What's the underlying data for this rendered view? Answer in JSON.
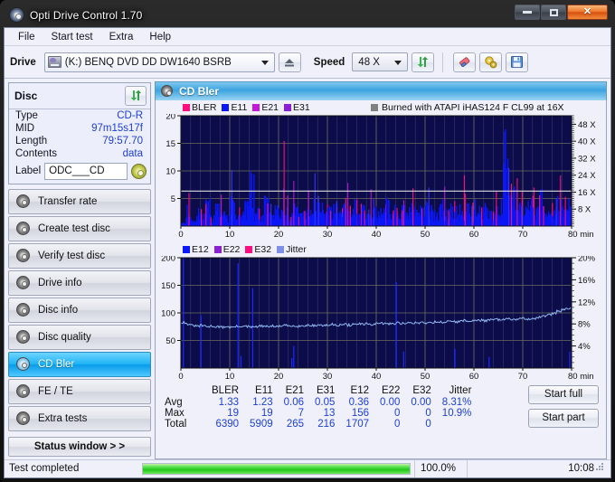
{
  "window": {
    "title": "Opti Drive Control 1.70",
    "icon": "disc-icon",
    "minimize": "–",
    "maximize": "□",
    "close": "✕"
  },
  "menu": {
    "items": [
      "File",
      "Start test",
      "Extra",
      "Help"
    ]
  },
  "toolbar": {
    "drive_label": "Drive",
    "drive_value": "(K:)  BENQ DVD DD DW1640 BSRB",
    "eject_icon": "eject-icon",
    "speed_label": "Speed",
    "speed_value": "48 X",
    "refresh_icon": "refresh-icon",
    "erase_icon": "eraser-icon",
    "settings_icon": "gears-icon",
    "save_icon": "floppy-save-icon"
  },
  "disc": {
    "title": "Disc",
    "refresh_icon": "refresh-icon",
    "rows": [
      {
        "key": "Type",
        "value": "CD-R"
      },
      {
        "key": "MID",
        "value": "97m15s17f"
      },
      {
        "key": "Length",
        "value": "79:57.70"
      },
      {
        "key": "Contents",
        "value": "data"
      }
    ],
    "label_key": "Label",
    "label_value": "ODC___CD",
    "label_icon": "cd-disc-icon"
  },
  "sidebar": {
    "items": [
      {
        "label": "Transfer rate",
        "icon": "disc-transfer-icon",
        "active": false
      },
      {
        "label": "Create test disc",
        "icon": "disc-create-icon",
        "active": false
      },
      {
        "label": "Verify test disc",
        "icon": "disc-verify-icon",
        "active": false
      },
      {
        "label": "Drive info",
        "icon": "drive-info-icon",
        "active": false
      },
      {
        "label": "Disc info",
        "icon": "disc-info-icon",
        "active": false
      },
      {
        "label": "Disc quality",
        "icon": "disc-quality-icon",
        "active": false
      },
      {
        "label": "CD Bler",
        "icon": "cd-bler-icon",
        "active": true
      },
      {
        "label": "FE / TE",
        "icon": "fe-te-icon",
        "active": false
      },
      {
        "label": "Extra tests",
        "icon": "extra-tests-icon",
        "active": false
      }
    ],
    "status_window": "Status window > >"
  },
  "content": {
    "panel_title": "CD Bler",
    "panel_icon": "cd-bler-icon"
  },
  "chart_data": [
    {
      "type": "bar",
      "name": "cd-bler-top-chart",
      "title": "",
      "annotation": "Burned with ATAPI iHAS124  F CL99 at 16X",
      "annotation_swatch": "#808080",
      "xlabel": "min",
      "ylabel": "",
      "x": [
        0,
        80
      ],
      "xticks": [
        0,
        10,
        20,
        30,
        40,
        50,
        60,
        70,
        80
      ],
      "xtick_labels": [
        "0",
        "10",
        "20",
        "30",
        "40",
        "50",
        "60",
        "70",
        "80 min"
      ],
      "ylim": [
        0,
        20
      ],
      "yticks": [
        5,
        10,
        15,
        20
      ],
      "ytick_labels": [
        "5",
        "10",
        "15",
        "20"
      ],
      "y2lim": [
        0,
        52
      ],
      "y2ticks": [
        8,
        16,
        24,
        32,
        40,
        48
      ],
      "y2tick_labels": [
        "8 X",
        "16 X",
        "24 X",
        "32 X",
        "40 X",
        "48 X"
      ],
      "grid": true,
      "legend": [
        {
          "name": "BLER",
          "color": "#ff0c7f"
        },
        {
          "name": "E11",
          "color": "#0b17f4"
        },
        {
          "name": "E21",
          "color": "#c318d7"
        },
        {
          "name": "E31",
          "color": "#8b1fd2"
        }
      ],
      "series": [
        {
          "name": "BLER",
          "color": "#ff0c7f",
          "values": [
            1.8,
            5.2,
            2.1,
            4.8,
            3.1,
            6.0,
            2.3,
            5.6,
            3.4,
            2.8,
            7.1,
            4.2,
            3.0,
            5.8,
            9.2,
            4.1,
            2.6,
            6.4,
            3.3,
            5.0,
            4.5,
            12.8,
            3.2,
            5.4,
            2.9,
            4.6,
            17.0,
            6.3,
            5.1,
            3.8,
            4.4,
            6.8,
            3.6,
            5.2,
            4.0,
            6.1,
            3.5,
            4.9,
            2.7,
            5.5,
            4.2,
            3.9,
            6.6,
            4.7,
            3.4,
            5.3,
            4.1,
            6.0,
            3.7,
            4.8,
            5.9,
            13.0,
            4.3,
            6.2,
            3.8,
            5.1,
            4.6,
            12.2,
            5.0,
            3.9,
            6.4,
            4.5,
            5.7,
            3.6,
            4.9,
            6.1,
            19.0,
            7.5,
            13.2,
            5.8,
            4.7,
            6.3,
            5.2,
            8.1,
            4.4,
            6.7,
            5.3,
            7.0,
            4.8,
            6.5
          ]
        },
        {
          "name": "E11",
          "color": "#0b17f4",
          "values": [
            1.2,
            3.8,
            1.5,
            3.2,
            2.1,
            4.5,
            1.7,
            3.9,
            2.4,
            1.9,
            5.0,
            3.0,
            2.2,
            4.1,
            10.2,
            2.9,
            1.8,
            4.6,
            2.3,
            3.5,
            3.1,
            2.8,
            2.2,
            3.7,
            2.0,
            3.2,
            2.8,
            4.4,
            3.6,
            2.6,
            3.1,
            4.7,
            2.5,
            3.6,
            2.8,
            4.2,
            2.4,
            3.4,
            1.9,
            3.8,
            2.9,
            2.7,
            4.6,
            3.3,
            2.4,
            3.7,
            2.9,
            4.2,
            2.6,
            3.4,
            4.1,
            3.2,
            3.0,
            4.3,
            2.7,
            3.6,
            3.2,
            4.0,
            3.5,
            2.7,
            4.5,
            3.1,
            4.0,
            2.5,
            3.4,
            4.3,
            18.5,
            5.2,
            6.0,
            4.1,
            3.3,
            4.4,
            3.6,
            5.7,
            3.1,
            4.7,
            3.7,
            4.9,
            3.4,
            4.6
          ]
        },
        {
          "name": "E21",
          "color": "#c318d7",
          "values": [
            0.06
          ]
        },
        {
          "name": "E31",
          "color": "#8b1fd2",
          "values": [
            0.05
          ]
        }
      ],
      "speed_series": {
        "name": "Speed",
        "color": "#d0d0d0",
        "description": "flat write-speed trace near 16X across the disc",
        "value": 16.5
      }
    },
    {
      "type": "line",
      "name": "cd-bler-bottom-chart",
      "title": "",
      "xlabel": "min",
      "x": [
        0,
        80
      ],
      "xticks": [
        0,
        10,
        20,
        30,
        40,
        50,
        60,
        70,
        80
      ],
      "xtick_labels": [
        "0",
        "10",
        "20",
        "30",
        "40",
        "50",
        "60",
        "70",
        "80 min"
      ],
      "ylim": [
        0,
        200
      ],
      "yticks": [
        50,
        100,
        150,
        200
      ],
      "ytick_labels": [
        "50",
        "100",
        "150",
        "200"
      ],
      "y2lim": [
        0,
        20
      ],
      "y2ticks": [
        4,
        8,
        12,
        16,
        20
      ],
      "y2tick_labels": [
        "4%",
        "8%",
        "12%",
        "16%",
        "20%"
      ],
      "grid": true,
      "legend": [
        {
          "name": "E12",
          "color": "#0b17f4"
        },
        {
          "name": "E22",
          "color": "#8b1fd2"
        },
        {
          "name": "E32",
          "color": "#ff0c7f"
        },
        {
          "name": "Jitter",
          "color": "#7f8fe8"
        }
      ],
      "series": [
        {
          "name": "Jitter",
          "color": "#8fb8f0",
          "axis": "right",
          "values": [
            8.3,
            8.0,
            7.7,
            7.6,
            7.7,
            7.5,
            7.6,
            7.5,
            7.4,
            7.5,
            7.4,
            7.5,
            7.6,
            7.5,
            7.4,
            7.5,
            7.6,
            7.5,
            7.6,
            7.5,
            7.6,
            7.7,
            7.6,
            7.7,
            7.6,
            7.7,
            7.8,
            7.7,
            7.8,
            7.7,
            7.8,
            7.9,
            7.8,
            7.9,
            7.8,
            7.9,
            8.0,
            7.9,
            8.0,
            7.9,
            8.0,
            8.1,
            8.0,
            8.1,
            8.2,
            8.1,
            8.2,
            8.1,
            8.2,
            8.3,
            8.2,
            8.3,
            8.4,
            8.3,
            8.4,
            8.5,
            8.4,
            8.5,
            8.6,
            8.5,
            8.6,
            8.7,
            8.6,
            8.7,
            8.8,
            8.7,
            8.8,
            8.9,
            8.8,
            8.9,
            9.0,
            8.9,
            9.0,
            9.2,
            9.4,
            9.6,
            9.9,
            10.3,
            10.7,
            10.9
          ]
        },
        {
          "name": "E12",
          "color": "#0b17f4",
          "axis": "left",
          "spikes": [
            {
              "x": 0.4,
              "y": 200
            },
            {
              "x": 4.0,
              "y": 96
            },
            {
              "x": 11.6,
              "y": 190
            },
            {
              "x": 14.6,
              "y": 145
            },
            {
              "x": 12.2,
              "y": 22
            },
            {
              "x": 23.0,
              "y": 40
            },
            {
              "x": 22.6,
              "y": 18
            },
            {
              "x": 44.0,
              "y": 156
            },
            {
              "x": 45.5,
              "y": 30
            },
            {
              "x": 56.0,
              "y": 35
            },
            {
              "x": 63.0,
              "y": 20
            },
            {
              "x": 79.5,
              "y": 30
            }
          ]
        },
        {
          "name": "E22",
          "color": "#8b1fd2",
          "axis": "left",
          "values": [
            0
          ]
        },
        {
          "name": "E32",
          "color": "#ff0c7f",
          "axis": "left",
          "values": [
            0
          ]
        }
      ]
    }
  ],
  "stats": {
    "columns": [
      "BLER",
      "E11",
      "E21",
      "E31",
      "E12",
      "E22",
      "E32",
      "Jitter"
    ],
    "rows": [
      {
        "label": "Avg",
        "values": [
          "1.33",
          "1.23",
          "0.06",
          "0.05",
          "0.36",
          "0.00",
          "0.00",
          "8.31%"
        ]
      },
      {
        "label": "Max",
        "values": [
          "19",
          "19",
          "7",
          "13",
          "156",
          "0",
          "0",
          "10.9%"
        ]
      },
      {
        "label": "Total",
        "values": [
          "6390",
          "5909",
          "265",
          "216",
          "1707",
          "0",
          "0",
          ""
        ]
      }
    ],
    "start_full": "Start full",
    "start_part": "Start part"
  },
  "statusbar": {
    "text": "Test completed",
    "percent": "100.0%",
    "progress_value": 100,
    "time": "10:08"
  },
  "colors": {
    "accent": "#3ea5e0",
    "plot_bg": "#0c0c4a",
    "grid": "#6b6b5e",
    "value_blue": "#1d3fd0",
    "progress_green": "#23c71a"
  }
}
